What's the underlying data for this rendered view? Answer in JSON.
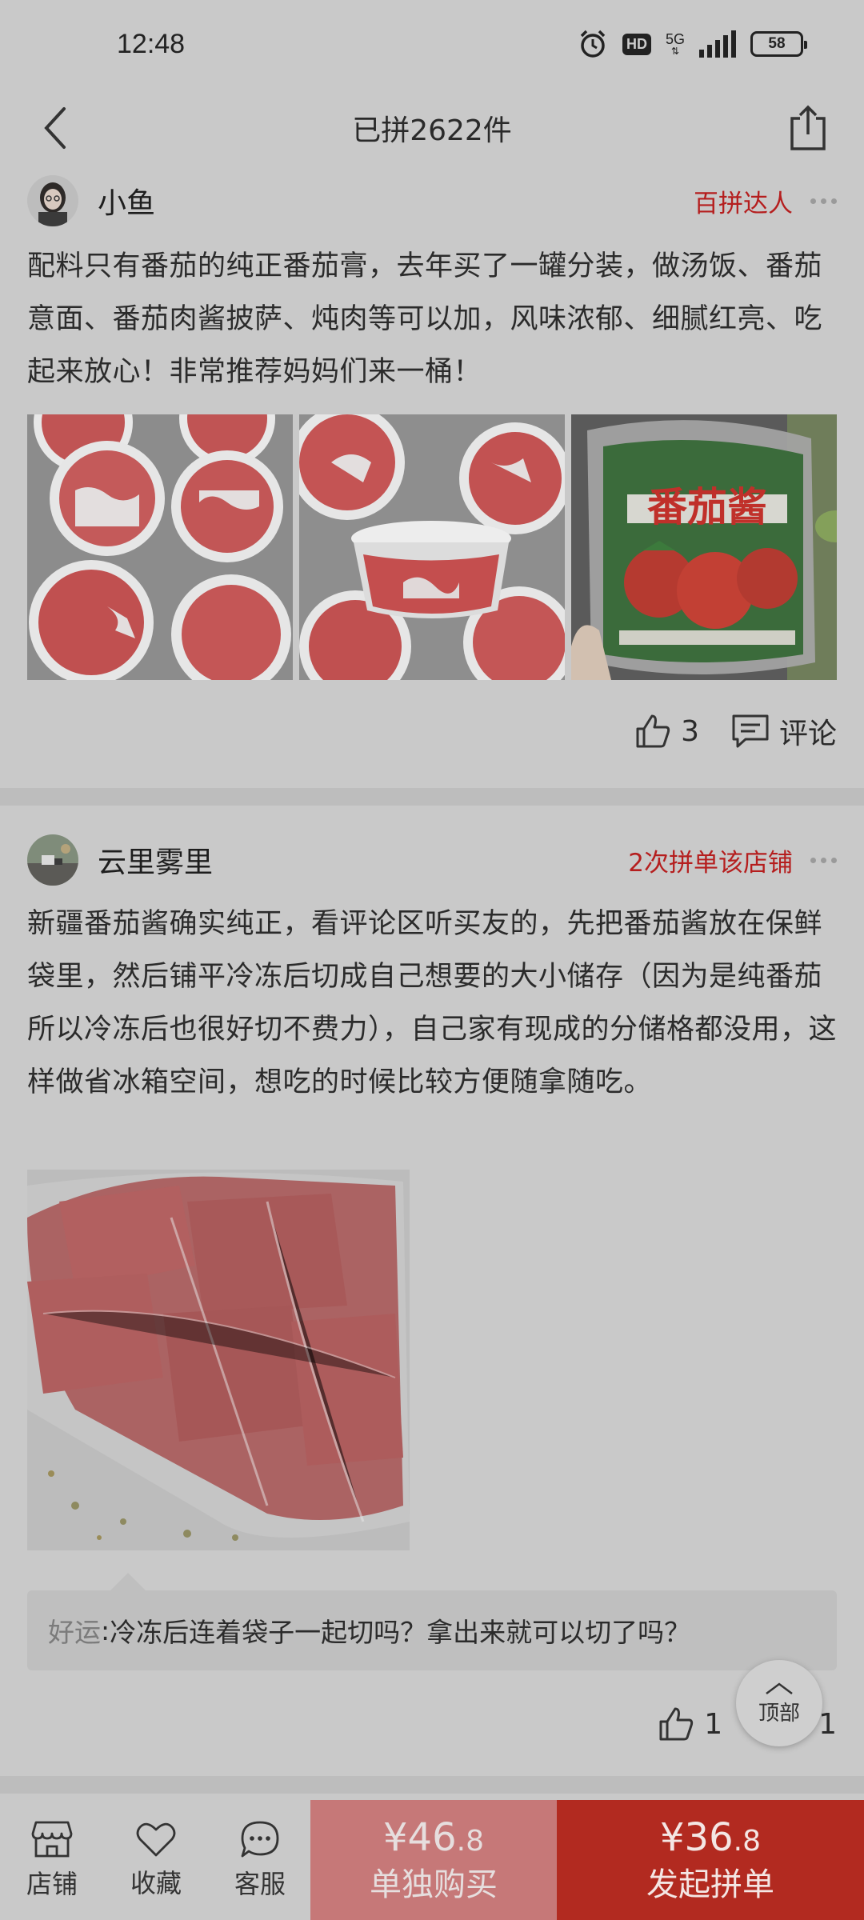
{
  "status_bar": {
    "time": "12:48",
    "hd": "HD",
    "network": "5G",
    "battery": "58"
  },
  "header": {
    "title": "已拼2622件"
  },
  "reviews": [
    {
      "username": "小鱼",
      "tag": "百拼达人",
      "text": "配料只有番茄的纯正番茄膏，去年买了一罐分装，做汤饭、番茄意面、番茄肉酱披萨、炖肉等可以加，风味浓郁、细腻红亮、吃起来放心！非常推荐妈妈们来一桶！",
      "photos": [
        "tomato-paste-containers-photo",
        "tomato-paste-cup-photo",
        "tomato-paste-can-photo"
      ],
      "can_label": "番茄酱",
      "likes": "3",
      "comment_label": "评论"
    },
    {
      "username": "云里雾里",
      "tag": "2次拼单该店铺",
      "text": "新疆番茄酱确实纯正，看评论区听买友的，先把番茄酱放在保鲜袋里，然后铺平冷冻后切成自己想要的大小储存（因为是纯番茄所以冷冻后也很好切不费力），自己家有现成的分储格都没用，这样做省冰箱空间，想吃的时候比较方便随拿随吃。",
      "photos": [
        "frozen-paste-bag-photo"
      ],
      "reply": {
        "name": "好运",
        "separator": ": ",
        "text": "冷冻后连着袋子一起切吗？拿出来就可以切了吗？"
      },
      "likes": "1",
      "comments": "1"
    }
  ],
  "top_button": {
    "label": "顶部"
  },
  "bottom_bar": {
    "shop": "店铺",
    "favorite": "收藏",
    "service": "客服",
    "single_buy": {
      "price_main": "¥46",
      "price_decimal": ".8",
      "label": "单独购买"
    },
    "group_buy": {
      "price_main": "¥36",
      "price_decimal": ".8",
      "label": "发起拼单"
    }
  },
  "colors": {
    "accent_red": "#b22a20",
    "tag_red": "#b51e1e",
    "single_btn": "#c67878",
    "background": "#c9c9c9"
  }
}
